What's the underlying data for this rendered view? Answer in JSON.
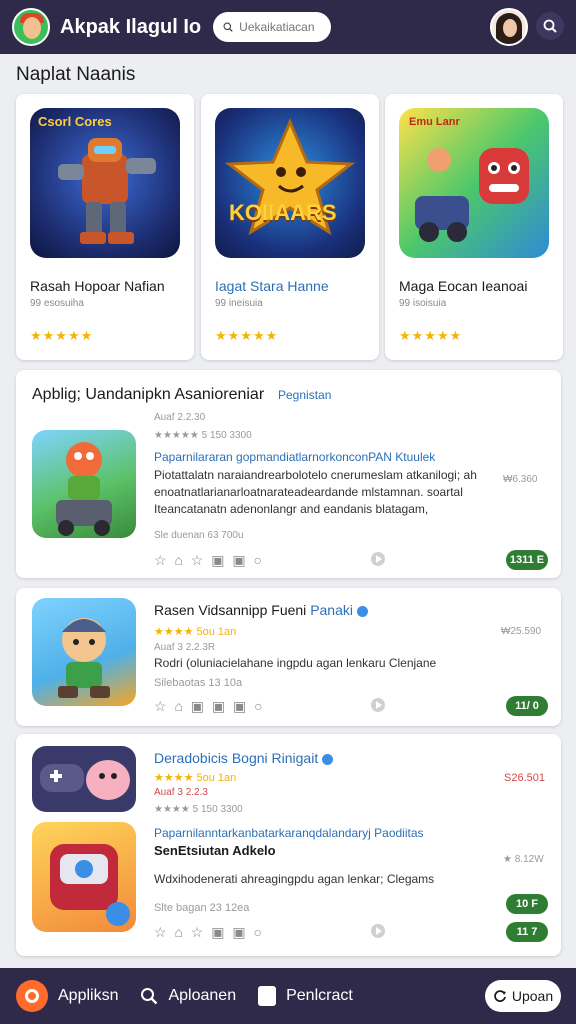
{
  "header": {
    "title": "Akpak Ilagul Io",
    "search_placeholder": "Uekaikatiacan"
  },
  "section_title": "Naplat Naanis",
  "featured": [
    {
      "art_label": "Csorl Cores",
      "name": "Rasah Hopoar Nafian",
      "sub": "99 esosuiha",
      "rating": "★★★★★"
    },
    {
      "art_label": "KOIIAARS",
      "name": "Iagat Stara Hanne",
      "sub": "99 ineisuia",
      "rating": "★★★★★"
    },
    {
      "art_label": "Emu Lanr",
      "name": "Maga Eocan Ieanoai",
      "sub": "99 isoisuia",
      "rating": "★★★★★"
    }
  ],
  "list": [
    {
      "title": "Apblig; Uandanipkn Asanioreniar",
      "tag": "Pegnistan",
      "meta1": "Auaf 2.2.30",
      "rating_line": "★★★★★ 5 150 3300",
      "desc_blue": "Paparnilararan gopmandiatlarnorkonconPAN Ktuulek",
      "desc": [
        "Piotattalatn naraiandrearbolotelo cnerumeslam atkanilogi; ah",
        "enoatnatlarianarloatnarateadeardande mlstamnan. soartal",
        "Iteancatanatn adenonlangr and eandanis blatagam,"
      ],
      "bottom": "Sle duenan 63 700u",
      "price": "₩6.360",
      "pill": "1311 E"
    },
    {
      "title": "Rasen Vidsannipp Fueni",
      "tag": "Panaki",
      "rating_line": "★★★★ 5ou 1an",
      "meta1": "Auaf 3 2.2.3R",
      "desc": "Rodri (oluniacielahane ingpdu agan lenkaru Clenjane",
      "bottom": "Silebaotas 13 10a",
      "price": "₩25.590",
      "pill": "11/ 0"
    },
    {
      "title": "Deradobicis Bogni",
      "tag": "Rinigait",
      "rating_line": "★★★★ 5ou 1an",
      "meta1": "Auaf 3 2.2.3",
      "meta2": "★★★★ 5 150 3300",
      "price": "S26.501",
      "desc_blue": "Paparnilanntarkanbatarkaranqdalandaryj Paodiitas",
      "desc_bold": "SenEtsiutan Adkelo",
      "price2": "★ 8.12W",
      "desc": "Wdxihodenerati ahreagingpdu agan lenkar; Clegams",
      "bottom": "Slte bagan 23 12ea",
      "pill1": "10 F",
      "pill2": "11 7"
    }
  ],
  "bottom_nav": [
    {
      "label": "Appliksn"
    },
    {
      "label": "Aploanen"
    },
    {
      "label": "Penlcract"
    }
  ],
  "upload_label": "Upoan",
  "colors": {
    "bar": "#2f2a4a",
    "accent": "#ff6b2c",
    "price_pill": "#2e7d32",
    "link": "#2c6fb8"
  }
}
